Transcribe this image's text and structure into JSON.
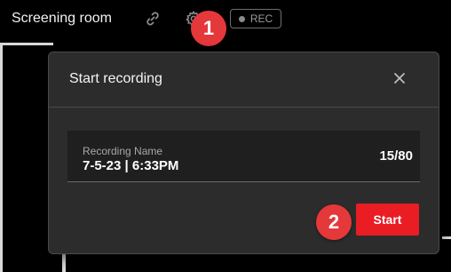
{
  "header": {
    "room_title": "Screening room",
    "link_icon": "link-icon",
    "settings_icon": "gear-icon",
    "rec_label": "REC"
  },
  "annotations": {
    "step_1": "1",
    "step_2": "2",
    "marker_color": "#e5383b"
  },
  "modal": {
    "title": "Start recording",
    "close_icon": "close-icon",
    "field": {
      "label": "Recording Name",
      "value": "7-5-23 | 6:33PM",
      "counter": "15/80"
    },
    "start_label": "Start",
    "accent_color": "#ea1c24"
  }
}
